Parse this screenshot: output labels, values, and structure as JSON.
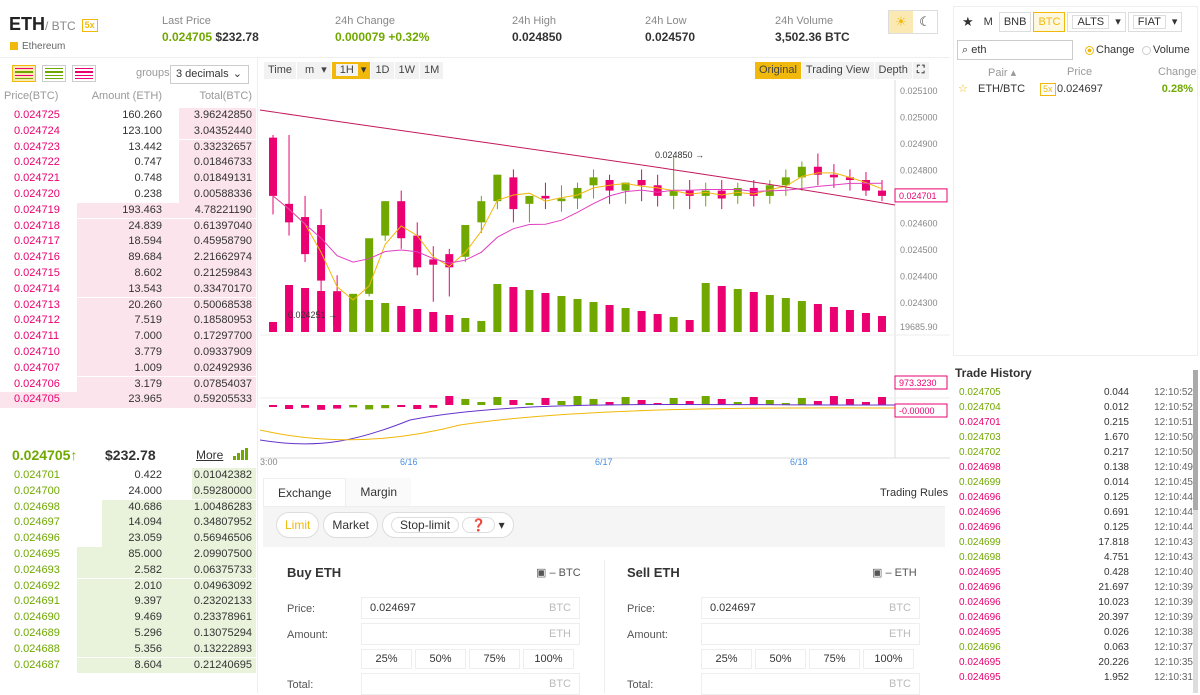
{
  "header": {
    "base": "ETH",
    "quote": "/ BTC",
    "leverage": "5x",
    "coin_name": "Ethereum",
    "stats": [
      {
        "label": "Last Price",
        "value": "0.024705",
        "value2": "$232.78"
      },
      {
        "label": "24h Change",
        "value": "0.000079",
        "value2": "+0.32%"
      },
      {
        "label": "24h High",
        "value": "0.024850"
      },
      {
        "label": "24h Low",
        "value": "0.024570"
      },
      {
        "label": "24h Volume",
        "value": "3,502.36 BTC"
      }
    ],
    "theme_light_icon": "sun-icon",
    "theme_dark_icon": "moon-icon"
  },
  "orderbook": {
    "groups_label": "groups",
    "groups_value": "3 decimals",
    "col_price": "Price(BTC)",
    "col_amount": "Amount (ETH)",
    "col_total": "Total(BTC)",
    "asks": [
      [
        "0.024725",
        "160.260",
        "3.96242850",
        0.3
      ],
      [
        "0.024724",
        "123.100",
        "3.04352440",
        0.3
      ],
      [
        "0.024723",
        "13.442",
        "0.33232657",
        0.3
      ],
      [
        "0.024722",
        "0.747",
        "0.01846733",
        0.3
      ],
      [
        "0.024721",
        "0.748",
        "0.01849131",
        0.3
      ],
      [
        "0.024720",
        "0.238",
        "0.00588336",
        0.3
      ],
      [
        "0.024719",
        "193.463",
        "4.78221190",
        0.7
      ],
      [
        "0.024718",
        "24.839",
        "0.61397040",
        0.7
      ],
      [
        "0.024717",
        "18.594",
        "0.45958790",
        0.7
      ],
      [
        "0.024716",
        "89.684",
        "2.21662974",
        0.7
      ],
      [
        "0.024715",
        "8.602",
        "0.21259843",
        0.7
      ],
      [
        "0.024714",
        "13.543",
        "0.33470170",
        0.7
      ],
      [
        "0.024713",
        "20.260",
        "0.50068538",
        0.7
      ],
      [
        "0.024712",
        "7.519",
        "0.18580953",
        0.7
      ],
      [
        "0.024711",
        "7.000",
        "0.17297700",
        0.7
      ],
      [
        "0.024710",
        "3.779",
        "0.09337909",
        0.7
      ],
      [
        "0.024707",
        "1.009",
        "0.02492936",
        0.7
      ],
      [
        "0.024706",
        "3.179",
        "0.07854037",
        0.7
      ],
      [
        "0.024705",
        "23.965",
        "0.59205533",
        1.0
      ]
    ],
    "mid_price": "0.024705",
    "mid_arrow": "↑",
    "mid_usd": "$232.78",
    "more_label": "More",
    "bids": [
      [
        "0.024701",
        "0.422",
        "0.01042382",
        0.25
      ],
      [
        "0.024700",
        "24.000",
        "0.59280000",
        0.25
      ],
      [
        "0.024698",
        "40.686",
        "1.00486283",
        0.6
      ],
      [
        "0.024697",
        "14.094",
        "0.34807952",
        0.6
      ],
      [
        "0.024696",
        "23.059",
        "0.56946506",
        0.6
      ],
      [
        "0.024695",
        "85.000",
        "2.09907500",
        0.7
      ],
      [
        "0.024693",
        "2.582",
        "0.06375733",
        0.7
      ],
      [
        "0.024692",
        "2.010",
        "0.04963092",
        0.7
      ],
      [
        "0.024691",
        "9.397",
        "0.23202133",
        0.7
      ],
      [
        "0.024690",
        "9.469",
        "0.23378961",
        0.7
      ],
      [
        "0.024689",
        "5.296",
        "0.13075294",
        0.7
      ],
      [
        "0.024688",
        "5.356",
        "0.13222893",
        0.7
      ],
      [
        "0.024687",
        "8.604",
        "0.21240695",
        0.7
      ]
    ]
  },
  "chart_toolbar": {
    "left": [
      "Time",
      "m",
      "1H",
      "1D",
      "1W",
      "1M"
    ],
    "right": [
      "Original",
      "Trading View",
      "Depth"
    ],
    "fullscreen_icon": "expand-icon"
  },
  "chart_data": {
    "type": "line",
    "title": "",
    "price_ticks": [
      "0.025100",
      "0.025000",
      "0.024900",
      "0.024800",
      "0.024701",
      "0.024600",
      "0.024500",
      "0.024400",
      "0.024300"
    ],
    "price_tag": "0.024701",
    "volume_tick": "19685.90",
    "volume_tag": "973.3230",
    "macd_tag": "-0.00000",
    "x_ticks": [
      "3:00",
      "6/16",
      "6/17",
      "6/18"
    ],
    "annotations": [
      {
        "label": "0.024850"
      },
      {
        "label": "0.024251"
      }
    ],
    "candles": [
      [
        0.02493,
        0.02492,
        0.0247,
        0.02463
      ],
      [
        0.02493,
        0.02467,
        0.0246,
        0.02455
      ],
      [
        0.0247,
        0.02462,
        0.02448,
        0.02445
      ],
      [
        0.02465,
        0.02459,
        0.02438,
        0.02433
      ],
      [
        0.0244,
        0.02434,
        0.02421,
        0.02425
      ],
      [
        0.02427,
        0.02426,
        0.02433,
        0.0242
      ],
      [
        0.02436,
        0.02433,
        0.02454,
        0.02432
      ],
      [
        0.02468,
        0.02455,
        0.02468,
        0.02453
      ],
      [
        0.02472,
        0.02468,
        0.02454,
        0.0245
      ],
      [
        0.0246,
        0.02455,
        0.02443,
        0.0244
      ],
      [
        0.02451,
        0.02446,
        0.02444,
        0.0243
      ],
      [
        0.0245,
        0.02448,
        0.02443,
        0.02432
      ],
      [
        0.02455,
        0.02447,
        0.02459,
        0.02445
      ],
      [
        0.0247,
        0.0246,
        0.02468,
        0.02456
      ],
      [
        0.02478,
        0.02468,
        0.02478,
        0.02465
      ],
      [
        0.0248,
        0.02477,
        0.02465,
        0.0246
      ],
      [
        0.0247,
        0.02467,
        0.0247,
        0.0246
      ],
      [
        0.02475,
        0.0247,
        0.02469,
        0.02465
      ],
      [
        0.02474,
        0.02468,
        0.02469,
        0.02464
      ],
      [
        0.02475,
        0.02469,
        0.02473,
        0.02465
      ],
      [
        0.0248,
        0.02474,
        0.02477,
        0.02469
      ],
      [
        0.02478,
        0.02476,
        0.02472,
        0.02467
      ],
      [
        0.02475,
        0.02472,
        0.02475,
        0.02467
      ],
      [
        0.0248,
        0.02476,
        0.02474,
        0.02468
      ],
      [
        0.02478,
        0.02474,
        0.0247,
        0.02466
      ],
      [
        0.02485,
        0.0247,
        0.02472,
        0.02465
      ],
      [
        0.02476,
        0.02472,
        0.0247,
        0.02465
      ],
      [
        0.02475,
        0.0247,
        0.02472,
        0.02466
      ],
      [
        0.02476,
        0.02472,
        0.02469,
        0.02465
      ],
      [
        0.02475,
        0.0247,
        0.02473,
        0.02467
      ],
      [
        0.02476,
        0.02473,
        0.0247,
        0.02466
      ],
      [
        0.02476,
        0.0247,
        0.02474,
        0.02467
      ],
      [
        0.0248,
        0.02474,
        0.02477,
        0.0247
      ],
      [
        0.02483,
        0.02477,
        0.02481,
        0.02472
      ],
      [
        0.02486,
        0.02481,
        0.02478,
        0.02474
      ],
      [
        0.02482,
        0.02478,
        0.02477,
        0.02473
      ],
      [
        0.0248,
        0.02477,
        0.02476,
        0.02472
      ],
      [
        0.02479,
        0.02476,
        0.02472,
        0.0247
      ],
      [
        0.02476,
        0.02472,
        0.0247,
        0.02468
      ]
    ]
  },
  "trade_form": {
    "tabs": [
      "Exchange",
      "Margin"
    ],
    "trading_rules": "Trading Rules",
    "order_types": [
      "Limit",
      "Market",
      "Stop-limit"
    ],
    "buy_title": "Buy ETH",
    "buy_wallet": "– BTC",
    "sell_title": "Sell ETH",
    "sell_wallet": "– ETH",
    "price_label": "Price:",
    "amount_label": "Amount:",
    "total_label": "Total:",
    "price_value": "0.024697",
    "btc": "BTC",
    "eth": "ETH",
    "pcts": [
      "25%",
      "50%",
      "75%",
      "100%"
    ]
  },
  "market": {
    "tabs": [
      "M",
      "BNB",
      "BTC",
      "ALTS",
      "FIAT"
    ],
    "star_icon": "star-icon",
    "search_value": "eth",
    "search_icon": "search-icon",
    "radio_change": "Change",
    "radio_volume": "Volume",
    "col_pair": "Pair",
    "col_price": "Price",
    "col_change": "Change",
    "rows": [
      {
        "pair": "ETH/BTC",
        "lev": "5x",
        "price": "0.024697",
        "change": "0.28%"
      }
    ]
  },
  "trade_history": {
    "title": "Trade History",
    "rows": [
      [
        "0.024705",
        "0.044",
        "12:10:52",
        "g"
      ],
      [
        "0.024704",
        "0.012",
        "12:10:52",
        "g"
      ],
      [
        "0.024701",
        "0.215",
        "12:10:51",
        "r"
      ],
      [
        "0.024703",
        "1.670",
        "12:10:50",
        "g"
      ],
      [
        "0.024702",
        "0.217",
        "12:10:50",
        "g"
      ],
      [
        "0.024698",
        "0.138",
        "12:10:49",
        "r"
      ],
      [
        "0.024699",
        "0.014",
        "12:10:45",
        "g"
      ],
      [
        "0.024696",
        "0.125",
        "12:10:44",
        "r"
      ],
      [
        "0.024696",
        "0.691",
        "12:10:44",
        "r"
      ],
      [
        "0.024696",
        "0.125",
        "12:10:44",
        "r"
      ],
      [
        "0.024699",
        "17.818",
        "12:10:43",
        "g"
      ],
      [
        "0.024698",
        "4.751",
        "12:10:43",
        "g"
      ],
      [
        "0.024695",
        "0.428",
        "12:10:40",
        "r"
      ],
      [
        "0.024696",
        "21.697",
        "12:10:39",
        "r"
      ],
      [
        "0.024696",
        "10.023",
        "12:10:39",
        "r"
      ],
      [
        "0.024696",
        "20.397",
        "12:10:39",
        "r"
      ],
      [
        "0.024695",
        "0.026",
        "12:10:38",
        "r"
      ],
      [
        "0.024696",
        "0.063",
        "12:10:37",
        "g"
      ],
      [
        "0.024695",
        "20.226",
        "12:10:35",
        "r"
      ],
      [
        "0.024695",
        "1.952",
        "12:10:31",
        "r"
      ]
    ]
  },
  "colors": {
    "accent": "#f0b90b",
    "up": "#70a800",
    "down": "#ea0070"
  }
}
